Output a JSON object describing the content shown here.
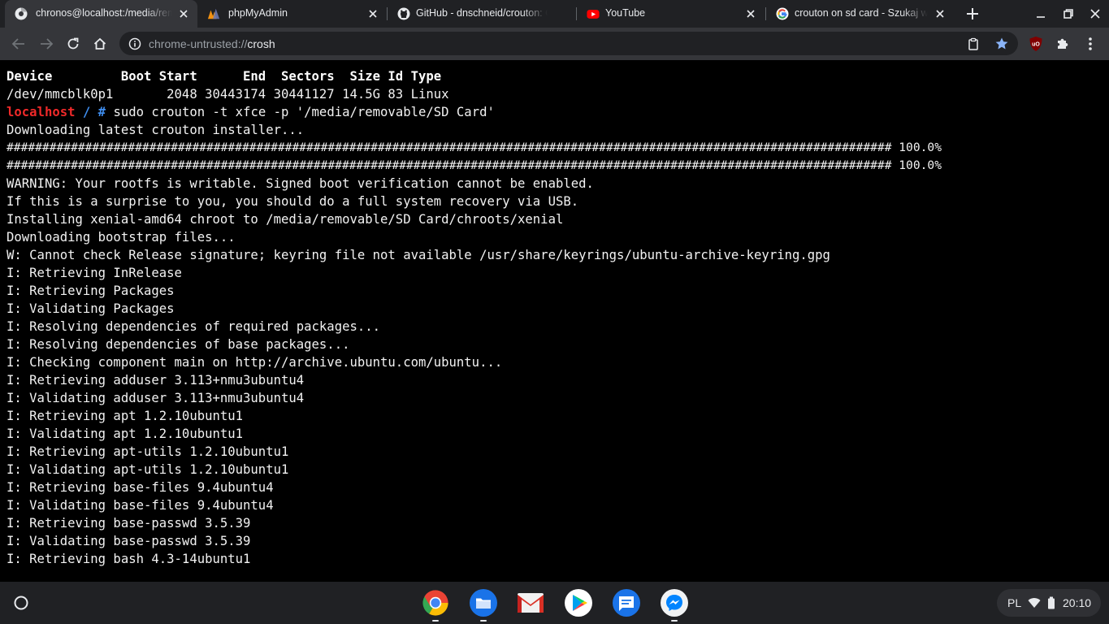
{
  "browser": {
    "tabs": [
      {
        "title": "chronos@localhost:/media/removable",
        "icon": "crosh-icon",
        "active": true
      },
      {
        "title": "phpMyAdmin",
        "icon": "phpmyadmin-icon",
        "active": false
      },
      {
        "title": "GitHub - dnschneid/crouton: Chromium OS",
        "icon": "github-icon",
        "active": false
      },
      {
        "title": "YouTube",
        "icon": "youtube-icon",
        "active": false
      },
      {
        "title": "crouton on sd card - Szukaj w Google",
        "icon": "google-icon",
        "active": false
      }
    ],
    "address": {
      "scheme": "chrome-untrusted://",
      "host": "crosh"
    }
  },
  "terminal": {
    "lines": [
      "Device         Boot Start      End  Sectors  Size Id Type",
      "/dev/mmcblk0p1       2048 30443174 30441127 14.5G 83 Linux",
      "",
      "Downloading latest crouton installer...",
      "############################################################################################################################ 100.0%",
      "############################################################################################################################ 100.0%",
      "WARNING: Your rootfs is writable. Signed boot verification cannot be enabled.",
      "If this is a surprise to you, you should do a full system recovery via USB.",
      "Installing xenial-amd64 chroot to /media/removable/SD Card/chroots/xenial",
      "Downloading bootstrap files...",
      "W: Cannot check Release signature; keyring file not available /usr/share/keyrings/ubuntu-archive-keyring.gpg",
      "I: Retrieving InRelease",
      "I: Retrieving Packages",
      "I: Validating Packages",
      "I: Resolving dependencies of required packages...",
      "I: Resolving dependencies of base packages...",
      "I: Checking component main on http://archive.ubuntu.com/ubuntu...",
      "I: Retrieving adduser 3.113+nmu3ubuntu4",
      "I: Validating adduser 3.113+nmu3ubuntu4",
      "I: Retrieving apt 1.2.10ubuntu1",
      "I: Validating apt 1.2.10ubuntu1",
      "I: Retrieving apt-utils 1.2.10ubuntu1",
      "I: Validating apt-utils 1.2.10ubuntu1",
      "I: Retrieving base-files 9.4ubuntu4",
      "I: Validating base-files 9.4ubuntu4",
      "I: Retrieving base-passwd 3.5.39",
      "I: Validating base-passwd 3.5.39",
      "I: Retrieving bash 4.3-14ubuntu1"
    ],
    "prompt": {
      "host": "localhost",
      "path": "/ #",
      "command": " sudo crouton -t xfce -p '/media/removable/SD Card'"
    },
    "colors": {
      "host": "#ef2929",
      "path": "#3f8ef0",
      "text": "#f2f2f2"
    }
  },
  "shelf": {
    "apps": [
      {
        "icon": "chrome-icon",
        "running": true
      },
      {
        "icon": "files-icon",
        "running": true
      },
      {
        "icon": "gmail-icon",
        "running": false
      },
      {
        "icon": "play-store-icon",
        "running": false
      },
      {
        "icon": "messages-icon",
        "running": false
      },
      {
        "icon": "messenger-icon",
        "running": true
      }
    ],
    "tray": {
      "language": "PL",
      "time": "20:10"
    }
  }
}
